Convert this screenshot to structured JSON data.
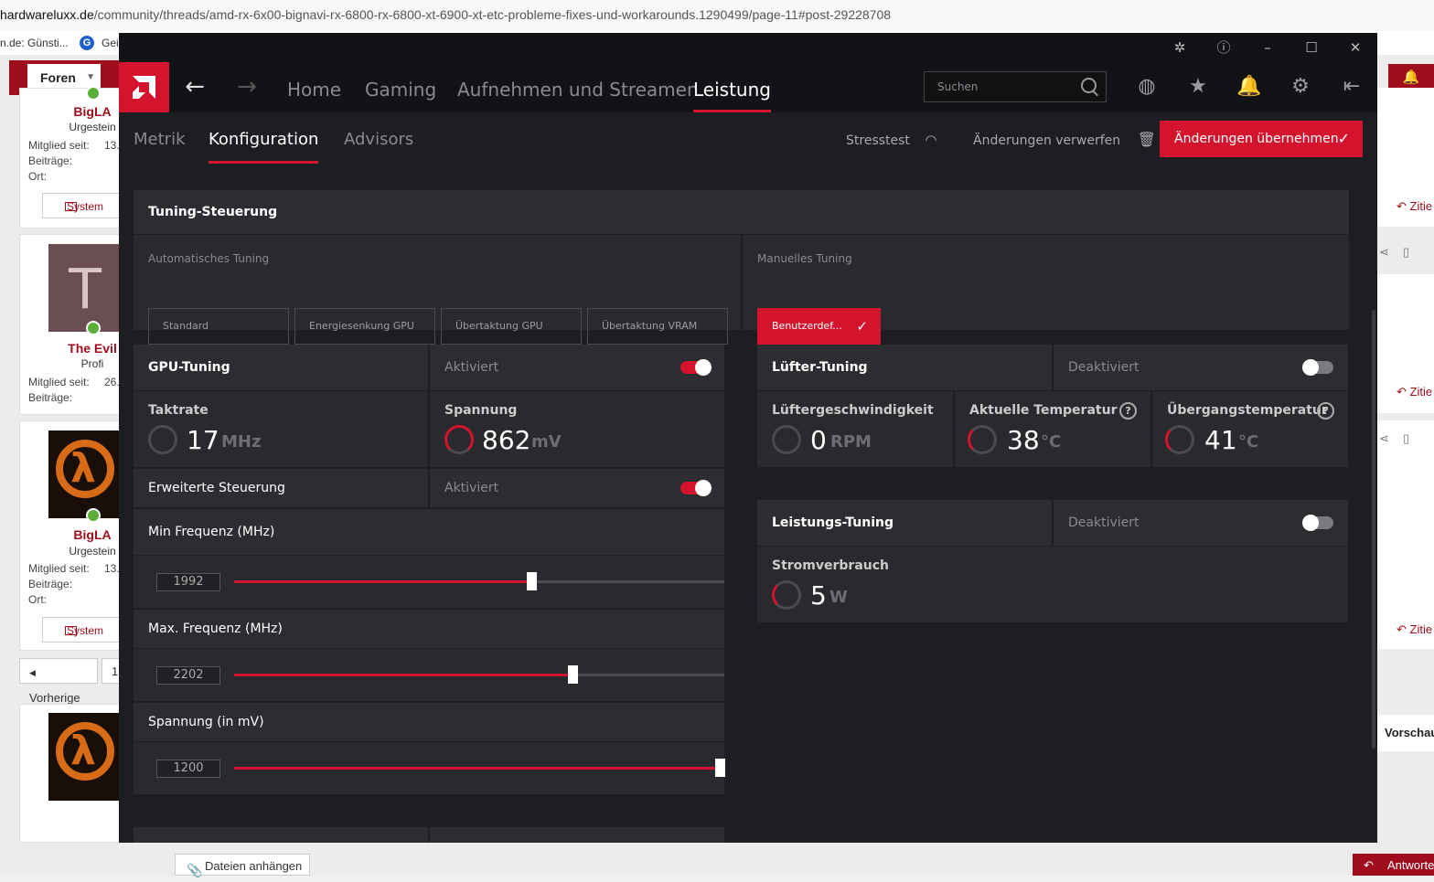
{
  "browser": {
    "url_host": "hardwareluxx.de",
    "url_path": "/community/threads/amd-rx-6x00-bignavi-rx-6800-rx-6800-xt-6900-xt-etc-probleme-fixes-und-workarounds.1290499/page-11#post-29228708",
    "bookmark_1": "n.de: Günsti...",
    "bookmark_2": "Gei",
    "bookmark_g": "G"
  },
  "forum": {
    "nav_button": "Foren",
    "users": [
      {
        "name": "BigLA",
        "rank": "Urgestein",
        "meta_labels": [
          "Mitglied seit:",
          "Beiträge:",
          "Ort:"
        ],
        "meta_value": "13.",
        "system_button": "System"
      },
      {
        "name": "The Evil",
        "rank": "Profi",
        "meta_labels": [
          "Mitglied seit:",
          "Beiträge:"
        ],
        "meta_value": "26.",
        "avatar_letter": "T"
      },
      {
        "name": "BigLA",
        "rank": "Urgestein",
        "meta_labels": [
          "Mitglied seit:",
          "Beiträge:",
          "Ort:"
        ],
        "meta_value": "13.",
        "system_button": "System"
      }
    ],
    "pager": {
      "prev": "Vorherige",
      "page": "1"
    },
    "zitie": "Zitie",
    "vorschau": "Vorschau",
    "attach": "Dateien anhängen",
    "reply": "Antworte"
  },
  "app": {
    "nav": {
      "tabs": [
        "Home",
        "Gaming",
        "Aufnehmen und Streamen",
        "Leistung"
      ],
      "active_tab": "Leistung",
      "search_placeholder": "Suchen"
    },
    "subnav": {
      "tabs": [
        "Metrik",
        "Konfiguration",
        "Advisors"
      ],
      "active_tab": "Konfiguration",
      "stresstest": "Stresstest",
      "discard": "Änderungen verwerfen",
      "apply": "Änderungen übernehmen"
    },
    "tuning_control": {
      "title": "Tuning-Steuerung",
      "auto_label": "Automatisches Tuning",
      "presets": [
        "Standard",
        "Energiesenkung GPU",
        "Übertaktung GPU",
        "Übertaktung VRAM"
      ],
      "manual_label": "Manuelles Tuning",
      "manual_selected": "Benutzerdef..."
    },
    "gpu_tuning": {
      "title": "GPU-Tuning",
      "state": "Aktiviert",
      "enabled": true,
      "clock_label": "Taktrate",
      "clock_value": "17",
      "clock_unit": "MHz",
      "voltage_label": "Spannung",
      "voltage_value": "862",
      "voltage_unit": "mV",
      "advanced_label": "Erweiterte Steuerung",
      "advanced_state": "Aktiviert",
      "advanced_enabled": true,
      "sliders": [
        {
          "label": "Min Frequenz (MHz)",
          "value": "1992",
          "fraction": 0.606
        },
        {
          "label": "Max. Frequenz (MHz)",
          "value": "2202",
          "fraction": 0.69
        },
        {
          "label": "Spannung (in mV)",
          "value": "1200",
          "fraction": 0.99
        }
      ]
    },
    "fan_tuning": {
      "title": "Lüfter-Tuning",
      "state": "Deaktiviert",
      "enabled": false,
      "speed_label": "Lüftergeschwindigkeit",
      "speed_value": "0",
      "speed_unit": "RPM",
      "temp_label": "Aktuelle Temperatur",
      "temp_value": "38",
      "temp_unit": "°C",
      "junction_label": "Übergangstemperatur",
      "junction_value": "41",
      "junction_unit": "°C"
    },
    "power_tuning": {
      "title": "Leistungs-Tuning",
      "state": "Deaktiviert",
      "enabled": false,
      "power_label": "Stromverbrauch",
      "power_value": "5",
      "power_unit": "W"
    },
    "colors": {
      "accent": "#d4142d",
      "panel": "#292a2e",
      "background": "#1d1e21"
    }
  }
}
